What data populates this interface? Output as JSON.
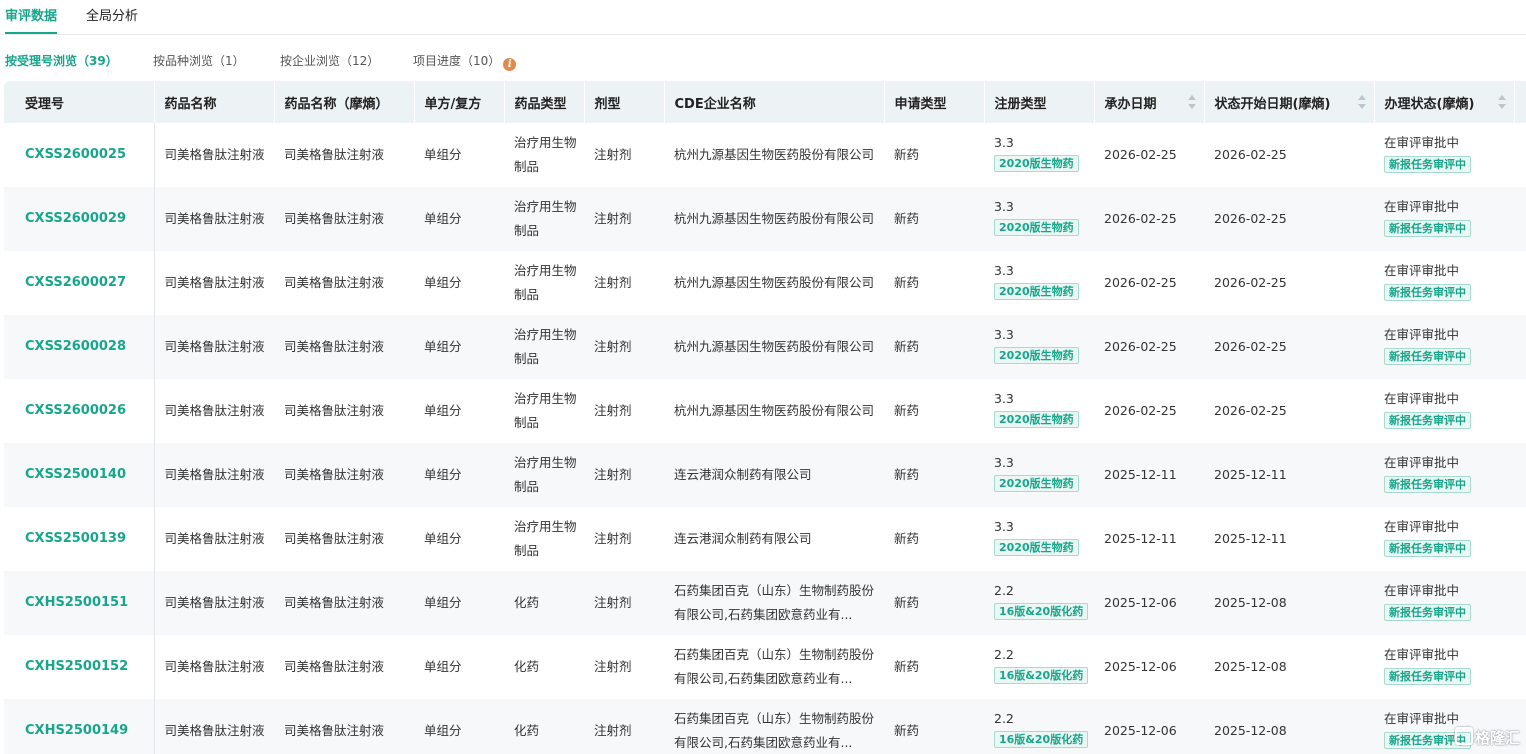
{
  "top_tabs": [
    "审评数据",
    "全局分析"
  ],
  "sub_tabs": [
    "按受理号浏览（39）",
    "按品种浏览（1）",
    "按企业浏览（12）",
    "项目进度（10）"
  ],
  "columns": [
    "受理号",
    "药品名称",
    "药品名称（摩熵）",
    "单方/复方",
    "药品类型",
    "剂型",
    "CDE企业名称",
    "申请类型",
    "注册类型",
    "承办日期",
    "状态开始日期(摩熵)",
    "办理状态(摩熵)"
  ],
  "rows": [
    {
      "id": "CXSS2600025",
      "name": "司美格鲁肽注射液",
      "name_m": "司美格鲁肽注射液",
      "combo": "单组分",
      "dtype": "治疗用生物制品",
      "form": "注射剂",
      "company": "杭州九源基因生物医药股份有限公司",
      "app_type": "新药",
      "reg_num": "3.3",
      "reg_tag": "2020版生物药",
      "date1": "2026-02-25",
      "date2": "2026-02-25",
      "status": "在审评审批中",
      "status_tag": "新报任务审评中"
    },
    {
      "id": "CXSS2600029",
      "name": "司美格鲁肽注射液",
      "name_m": "司美格鲁肽注射液",
      "combo": "单组分",
      "dtype": "治疗用生物制品",
      "form": "注射剂",
      "company": "杭州九源基因生物医药股份有限公司",
      "app_type": "新药",
      "reg_num": "3.3",
      "reg_tag": "2020版生物药",
      "date1": "2026-02-25",
      "date2": "2026-02-25",
      "status": "在审评审批中",
      "status_tag": "新报任务审评中"
    },
    {
      "id": "CXSS2600027",
      "name": "司美格鲁肽注射液",
      "name_m": "司美格鲁肽注射液",
      "combo": "单组分",
      "dtype": "治疗用生物制品",
      "form": "注射剂",
      "company": "杭州九源基因生物医药股份有限公司",
      "app_type": "新药",
      "reg_num": "3.3",
      "reg_tag": "2020版生物药",
      "date1": "2026-02-25",
      "date2": "2026-02-25",
      "status": "在审评审批中",
      "status_tag": "新报任务审评中"
    },
    {
      "id": "CXSS2600028",
      "name": "司美格鲁肽注射液",
      "name_m": "司美格鲁肽注射液",
      "combo": "单组分",
      "dtype": "治疗用生物制品",
      "form": "注射剂",
      "company": "杭州九源基因生物医药股份有限公司",
      "app_type": "新药",
      "reg_num": "3.3",
      "reg_tag": "2020版生物药",
      "date1": "2026-02-25",
      "date2": "2026-02-25",
      "status": "在审评审批中",
      "status_tag": "新报任务审评中"
    },
    {
      "id": "CXSS2600026",
      "name": "司美格鲁肽注射液",
      "name_m": "司美格鲁肽注射液",
      "combo": "单组分",
      "dtype": "治疗用生物制品",
      "form": "注射剂",
      "company": "杭州九源基因生物医药股份有限公司",
      "app_type": "新药",
      "reg_num": "3.3",
      "reg_tag": "2020版生物药",
      "date1": "2026-02-25",
      "date2": "2026-02-25",
      "status": "在审评审批中",
      "status_tag": "新报任务审评中"
    },
    {
      "id": "CXSS2500140",
      "name": "司美格鲁肽注射液",
      "name_m": "司美格鲁肽注射液",
      "combo": "单组分",
      "dtype": "治疗用生物制品",
      "form": "注射剂",
      "company": "连云港润众制药有限公司",
      "app_type": "新药",
      "reg_num": "3.3",
      "reg_tag": "2020版生物药",
      "date1": "2025-12-11",
      "date2": "2025-12-11",
      "status": "在审评审批中",
      "status_tag": "新报任务审评中"
    },
    {
      "id": "CXSS2500139",
      "name": "司美格鲁肽注射液",
      "name_m": "司美格鲁肽注射液",
      "combo": "单组分",
      "dtype": "治疗用生物制品",
      "form": "注射剂",
      "company": "连云港润众制药有限公司",
      "app_type": "新药",
      "reg_num": "3.3",
      "reg_tag": "2020版生物药",
      "date1": "2025-12-11",
      "date2": "2025-12-11",
      "status": "在审评审批中",
      "status_tag": "新报任务审评中"
    },
    {
      "id": "CXHS2500151",
      "name": "司美格鲁肽注射液",
      "name_m": "司美格鲁肽注射液",
      "combo": "单组分",
      "dtype": "化药",
      "form": "注射剂",
      "company": "石药集团百克（山东）生物制药股份有限公司,石药集团欧意药业有...",
      "app_type": "新药",
      "reg_num": "2.2",
      "reg_tag": "16版&20版化药",
      "date1": "2025-12-06",
      "date2": "2025-12-08",
      "status": "在审评审批中",
      "status_tag": "新报任务审评中"
    },
    {
      "id": "CXHS2500152",
      "name": "司美格鲁肽注射液",
      "name_m": "司美格鲁肽注射液",
      "combo": "单组分",
      "dtype": "化药",
      "form": "注射剂",
      "company": "石药集团百克（山东）生物制药股份有限公司,石药集团欧意药业有...",
      "app_type": "新药",
      "reg_num": "2.2",
      "reg_tag": "16版&20版化药",
      "date1": "2025-12-06",
      "date2": "2025-12-08",
      "status": "在审评审批中",
      "status_tag": "新报任务审评中"
    },
    {
      "id": "CXHS2500149",
      "name": "司美格鲁肽注射液",
      "name_m": "司美格鲁肽注射液",
      "combo": "单组分",
      "dtype": "化药",
      "form": "注射剂",
      "company": "石药集团百克（山东）生物制药股份有限公司,石药集团欧意药业有...",
      "app_type": "新药",
      "reg_num": "2.2",
      "reg_tag": "16版&20版化药",
      "date1": "2025-12-06",
      "date2": "2025-12-08",
      "status": "在审评审批中",
      "status_tag": "新报任务审评中"
    }
  ],
  "watermark": "格隆汇",
  "colors": {
    "accent": "#17a68c",
    "header_bg": "#edf3f4",
    "info_icon": "#e08a4f"
  }
}
